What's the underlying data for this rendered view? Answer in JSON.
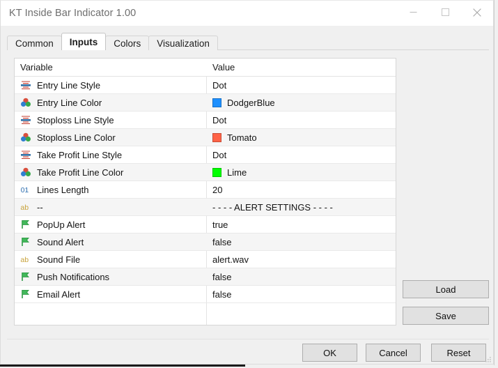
{
  "window": {
    "title": "KT Inside Bar Indicator 1.00",
    "controls": [
      {
        "name": "minimize",
        "label": "Minimize"
      },
      {
        "name": "maximize",
        "label": "Maximize"
      },
      {
        "name": "close",
        "label": "Close"
      }
    ]
  },
  "tabs": [
    {
      "label": "Common",
      "selected": false
    },
    {
      "label": "Inputs",
      "selected": true
    },
    {
      "label": "Colors",
      "selected": false
    },
    {
      "label": "Visualization",
      "selected": false
    }
  ],
  "table": {
    "headers": {
      "variable": "Variable",
      "value": "Value"
    },
    "rows": [
      {
        "icon": "line-style-icon",
        "variable": "Entry Line Style",
        "value": "Dot",
        "swatch": null
      },
      {
        "icon": "color-icon",
        "variable": "Entry Line Color",
        "value": "DodgerBlue",
        "swatch": "#1E90FF"
      },
      {
        "icon": "line-style-icon",
        "variable": "Stoploss Line Style",
        "value": "Dot",
        "swatch": null
      },
      {
        "icon": "color-icon",
        "variable": "Stoploss Line Color",
        "value": "Tomato",
        "swatch": "#FF6347"
      },
      {
        "icon": "line-style-icon",
        "variable": "Take Profit Line Style",
        "value": "Dot",
        "swatch": null
      },
      {
        "icon": "color-icon",
        "variable": "Take Profit Line Color",
        "value": "Lime",
        "swatch": "#00FF00"
      },
      {
        "icon": "integer-icon",
        "variable": "Lines Length",
        "value": "20",
        "swatch": null
      },
      {
        "icon": "string-icon",
        "variable": "--",
        "value": "- - - - ALERT SETTINGS - - - -",
        "swatch": null
      },
      {
        "icon": "boolean-icon",
        "variable": "PopUp Alert",
        "value": "true",
        "swatch": null
      },
      {
        "icon": "boolean-icon",
        "variable": "Sound Alert",
        "value": "false",
        "swatch": null
      },
      {
        "icon": "string-icon",
        "variable": "Sound File",
        "value": "alert.wav",
        "swatch": null
      },
      {
        "icon": "boolean-icon",
        "variable": "Push Notifications",
        "value": "false",
        "swatch": null
      },
      {
        "icon": "boolean-icon",
        "variable": "Email Alert",
        "value": "false",
        "swatch": null
      }
    ]
  },
  "side_buttons": {
    "load": "Load",
    "save": "Save"
  },
  "footer_buttons": {
    "ok": "OK",
    "cancel": "Cancel",
    "reset": "Reset"
  },
  "colors": {
    "dodger_blue": "#1E90FF",
    "tomato": "#FF6347",
    "lime": "#00FF00",
    "window_bg": "#F0F0F0",
    "table_bg": "#FFFFFF",
    "alt_row_bg": "#F5F5F5",
    "title_text": "#6E6E6E"
  }
}
